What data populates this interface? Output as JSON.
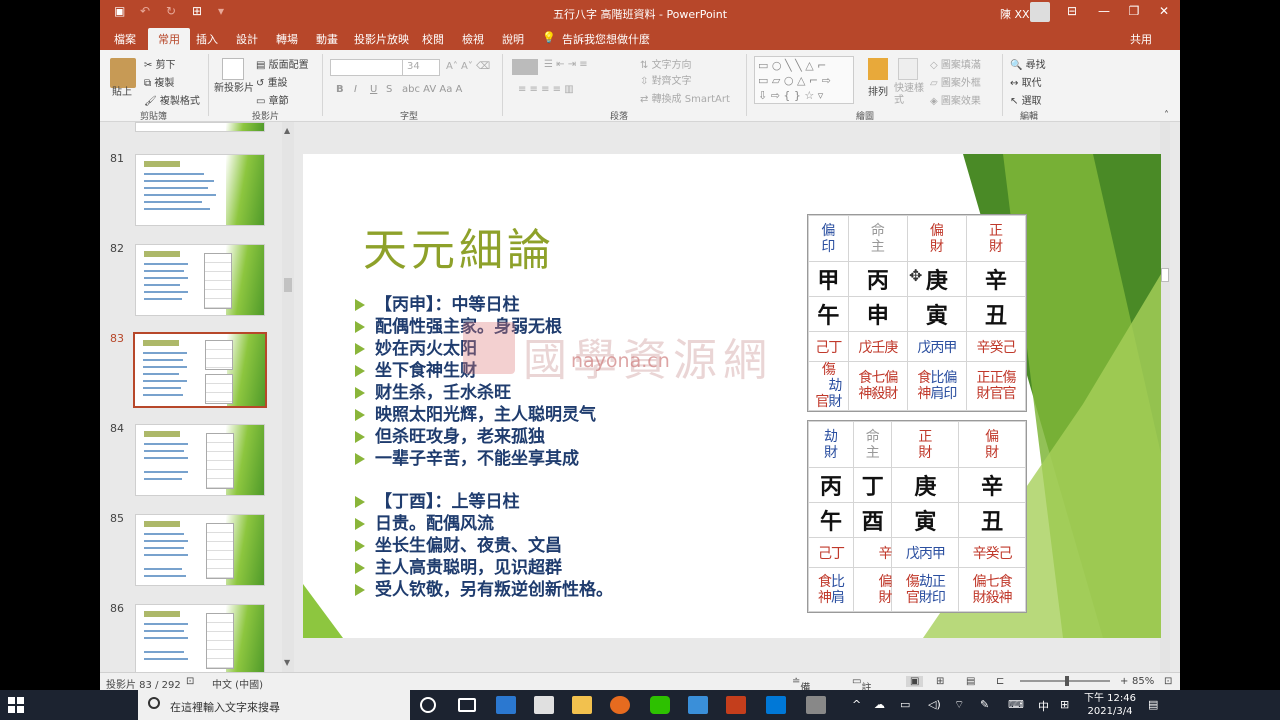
{
  "titlebar": {
    "document_title": "五行八字 高階班資料 - PowerPoint",
    "user": "陳 XX",
    "save_icon": "save-icon",
    "undo_icon": "undo-icon",
    "redo_icon": "redo-icon",
    "present_icon": "present-icon"
  },
  "tabs": [
    "檔案",
    "常用",
    "插入",
    "設計",
    "轉場",
    "動畫",
    "投影片放映",
    "校閱",
    "檢視",
    "說明",
    "告訴我您想做什麼",
    "共用"
  ],
  "ribbon": {
    "clipboard": {
      "paste": "貼上",
      "cut": "剪下",
      "copy": "複製",
      "format_painter": "複製格式",
      "label": "剪貼簿"
    },
    "slides": {
      "new_slide": "新投影片",
      "layout": "版面配置",
      "reset": "重設",
      "section": "章節",
      "label": "投影片"
    },
    "font": {
      "font_name": "",
      "font_size": "34",
      "bold": "B",
      "italic": "I",
      "underline": "U",
      "strike": "S",
      "label": "字型"
    },
    "paragraph": {
      "text_direction": "文字方向",
      "align_text": "對齊文字",
      "smartart": "轉換成 SmartArt",
      "label": "段落"
    },
    "drawing": {
      "arrange": "排列",
      "quick_styles": "快速樣式",
      "fill": "圖案填滿",
      "outline": "圖案外框",
      "effects": "圖案效果",
      "label": "繪圖"
    },
    "editing": {
      "find": "尋找",
      "replace": "取代",
      "select": "選取",
      "label": "編輯"
    }
  },
  "thumbnails": [
    {
      "num": "81",
      "selected": false
    },
    {
      "num": "82",
      "selected": false
    },
    {
      "num": "83",
      "selected": true
    },
    {
      "num": "84",
      "selected": false
    },
    {
      "num": "85",
      "selected": false
    },
    {
      "num": "86",
      "selected": false
    }
  ],
  "slide": {
    "title": "天元細論",
    "bullets": [
      "【丙申】：中等日柱",
      "配偶性强主家。身弱无根",
      "妙在丙火太阳",
      "坐下食神生财",
      "财生杀，壬水杀旺",
      "映照太阳光辉，主人聪明灵气",
      "但杀旺攻身，老来孤独",
      "一辈子辛苦，不能坐享其成",
      "",
      "【丁酉】：上等日柱",
      "日贵。配偶风流",
      "坐长生偏财、夜贵、文昌",
      "主人高贵聪明，见识超群",
      "受人钦敬，另有叛逆创新性格。"
    ],
    "chart1": {
      "gods": [
        [
          "偏",
          "印"
        ],
        [
          "命",
          "主"
        ],
        [
          "偏",
          "財"
        ],
        [
          "正",
          "財"
        ]
      ],
      "god_colors": [
        "#2b4fa0",
        "#999999",
        "#c0392b",
        "#c0392b"
      ],
      "stems": [
        "甲",
        "丙",
        "庚",
        "辛"
      ],
      "branches": [
        "午",
        "申",
        "寅",
        "丑"
      ],
      "hidden": [
        [
          "己丁"
        ],
        [
          "戊壬庚"
        ],
        [
          "戊丙甲"
        ],
        [
          "辛癸己"
        ]
      ],
      "hidden_gods": [
        [
          "傷",
          "官"
        ],
        [
          "劫",
          "財"
        ],
        [
          "食",
          "神"
        ],
        [
          "七",
          "殺"
        ],
        [
          "偏",
          "財"
        ],
        [
          "食",
          "神"
        ],
        [
          "比",
          "肩"
        ],
        [
          "偏",
          "印"
        ],
        [
          "正",
          "財"
        ],
        [
          "正",
          "官"
        ],
        [
          "傷",
          "官"
        ]
      ]
    },
    "chart2": {
      "gods": [
        [
          "劫",
          "財"
        ],
        [
          "命",
          "主"
        ],
        [
          "正",
          "財"
        ],
        [
          "偏",
          "財"
        ]
      ],
      "god_colors": [
        "#2b4fa0",
        "#999999",
        "#c0392b",
        "#c0392b"
      ],
      "stems": [
        "丙",
        "丁",
        "庚",
        "辛"
      ],
      "branches": [
        "午",
        "酉",
        "寅",
        "丑"
      ],
      "hidden": [
        [
          "己丁"
        ],
        [
          "辛"
        ],
        [
          "戊丙甲"
        ],
        [
          "辛癸己"
        ]
      ]
    },
    "watermark": "國學資源網",
    "watermark_url": "nayona.cn"
  },
  "statusbar": {
    "slide_info": "投影片 83 / 292",
    "language": "中文 (中國)",
    "notes": "備忘稿",
    "comments": "註解",
    "zoom": "85%",
    "zoom_level": 0.85
  },
  "taskbar": {
    "search_placeholder": "在這裡輸入文字來搜尋",
    "time": "下午 12:46",
    "date": "2021/3/4",
    "ime": "中"
  }
}
